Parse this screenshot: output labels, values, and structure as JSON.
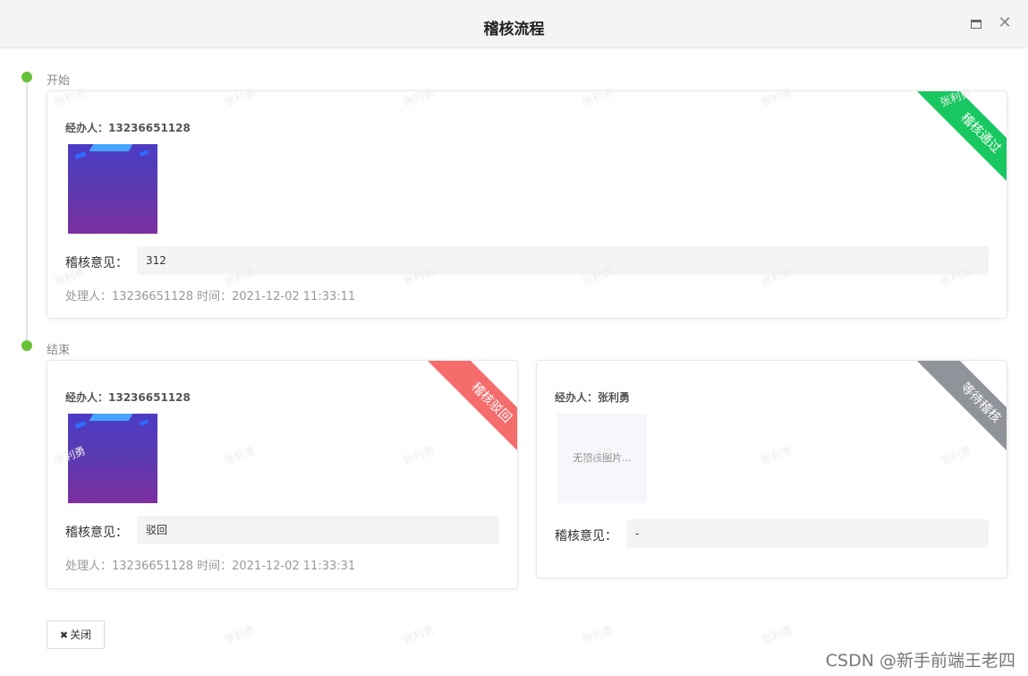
{
  "window": {
    "title": "稽核流程"
  },
  "watermark": "张利勇",
  "timeline": [
    {
      "label": "开始",
      "cards": [
        {
          "operator": "经办人：13236651128",
          "has_image": true,
          "opinion_label": "稽核意见：",
          "opinion": "312",
          "handler": "处理人：13236651128 时间：2021-12-02 11:33:11",
          "status": "稽核通过",
          "status_color": "#19c760"
        }
      ]
    },
    {
      "label": "结束",
      "cards": [
        {
          "operator": "经办人：13236651128",
          "has_image": true,
          "opinion_label": "稽核意见：",
          "opinion": "驳回",
          "handler": "处理人：13236651128 时间：2021-12-02 11:33:31",
          "status": "稽核驳回",
          "status_color": "#f56c6c"
        },
        {
          "operator": "经办人：张利勇",
          "has_image": false,
          "no_image_text": "无稽核图片...",
          "opinion_label": "稽核意见：",
          "opinion": "-",
          "status": "等待稽核",
          "status_color": "#909399"
        }
      ]
    }
  ],
  "footer": {
    "close_icon": "x-icon",
    "close_label": "关闭"
  },
  "credit": "CSDN @新手前端王老四"
}
